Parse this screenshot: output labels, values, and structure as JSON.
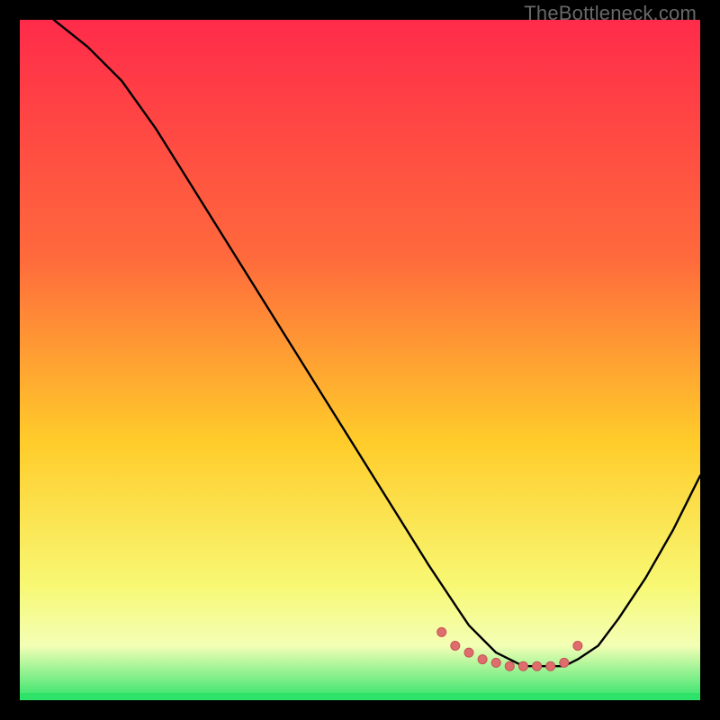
{
  "watermark": "TheBottleneck.com",
  "colors": {
    "top": "#ff2b4a",
    "mid1": "#ff6a3c",
    "mid2": "#ffcc2a",
    "mid3": "#f8f873",
    "bottom_band": "#f3ffb5",
    "green": "#2fe36a",
    "curve": "#000000",
    "marker_fill": "#e06d6d",
    "marker_stroke": "#c45454"
  },
  "chart_data": {
    "type": "line",
    "title": "",
    "xlabel": "",
    "ylabel": "",
    "xlim": [
      0,
      100
    ],
    "ylim": [
      0,
      100
    ],
    "x": [
      5,
      10,
      15,
      20,
      25,
      30,
      35,
      40,
      45,
      50,
      55,
      60,
      62,
      64,
      66,
      68,
      70,
      72,
      74,
      76,
      78,
      80,
      82,
      85,
      88,
      92,
      96,
      100
    ],
    "values": [
      100,
      96,
      91,
      84,
      76,
      68,
      60,
      52,
      44,
      36,
      28,
      20,
      17,
      14,
      11,
      9,
      7,
      6,
      5,
      5,
      5,
      5,
      6,
      8,
      12,
      18,
      25,
      33
    ],
    "markers_x": [
      62,
      64,
      66,
      68,
      70,
      72,
      74,
      76,
      78,
      80,
      82
    ],
    "markers_y": [
      10,
      8,
      7,
      6,
      5.5,
      5,
      5,
      5,
      5,
      5.5,
      8
    ]
  }
}
